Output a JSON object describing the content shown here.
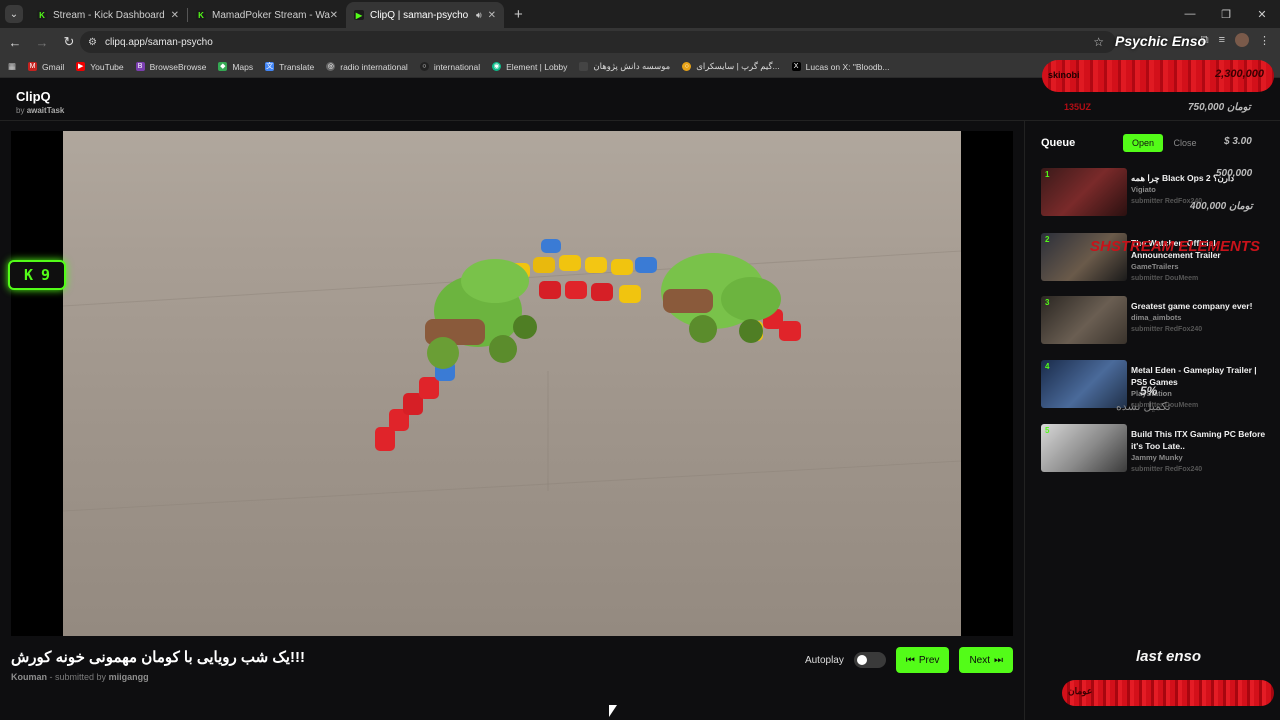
{
  "browser": {
    "tabs": [
      {
        "title": "Stream - Kick Dashboard",
        "favicon": "kick-icon"
      },
      {
        "title": "MamadPoker Stream - Watch L",
        "favicon": "kick-icon"
      },
      {
        "title": "ClipQ | saman-psycho",
        "favicon": "play-icon",
        "active": true
      }
    ],
    "new_tab": "+",
    "url": "clipq.app/saman-psycho",
    "bookmarks": [
      "Gmail",
      "YouTube",
      "BrowseBrowse",
      "Maps",
      "Translate",
      "radio international",
      "international",
      "Element | Lobby",
      "موسسه دانش پژوهان",
      "گیم گرپ | سایسکرای...",
      "Lucas on X: \"Bloodb..."
    ]
  },
  "app": {
    "brand": "ClipQ",
    "by_prefix": "by",
    "by_name": "awaitTask"
  },
  "player": {
    "badge_count": "9",
    "clip_title": "یک شب رویایی با کومان مهمونی خونه کورش!!!",
    "channel": "Kouman",
    "submitted_by_label": "- submitted by",
    "submitter": "miigangg",
    "autoplay_label": "Autoplay",
    "autoplay_on": false,
    "prev_label": "Prev",
    "next_label": "Next"
  },
  "queue": {
    "title": "Queue",
    "open_label": "Open",
    "close_label": "Close",
    "items": [
      {
        "num": "1",
        "title": "چرا همه Black Ops 2 دارن؟",
        "channel": "Vigiato",
        "submitter": "submitter RedFox240"
      },
      {
        "num": "2",
        "title": "The Watcher: Official Announcement Trailer",
        "channel": "GameTrailers",
        "submitter": "submitter DouMeem"
      },
      {
        "num": "3",
        "title": "Greatest game company ever!",
        "channel": "dima_aimbots",
        "submitter": "submitter RedFox240"
      },
      {
        "num": "4",
        "title": "Metal Eden - Gameplay Trailer | PS5 Games",
        "channel": "PlayStation",
        "submitter": "submitter DouMeem"
      },
      {
        "num": "5",
        "title": "Build This ITX Gaming PC Before it's Too Late..",
        "channel": "Jammy Munky",
        "submitter": "submitter RedFox240"
      }
    ]
  },
  "overlay": {
    "enso_title": "Psychic Enso",
    "bar_left": "skinobi",
    "bar_amount": "2,300,000",
    "amount_2": "750,000 تومان",
    "red_1": "135UZ",
    "amount_usd": "$ 3.00",
    "amount_3": "500,000",
    "amount_4": "400,000 تومان",
    "streamlabel": "SHSTREAM ELEMENTS",
    "percent": "5%",
    "not_done": "تکمیل نشده",
    "last_label": "last enso",
    "last_bar": "عومان"
  },
  "colors": {
    "accent": "#53fc18",
    "bg": "#0e0e10",
    "overlay_red": "#d3101a"
  }
}
